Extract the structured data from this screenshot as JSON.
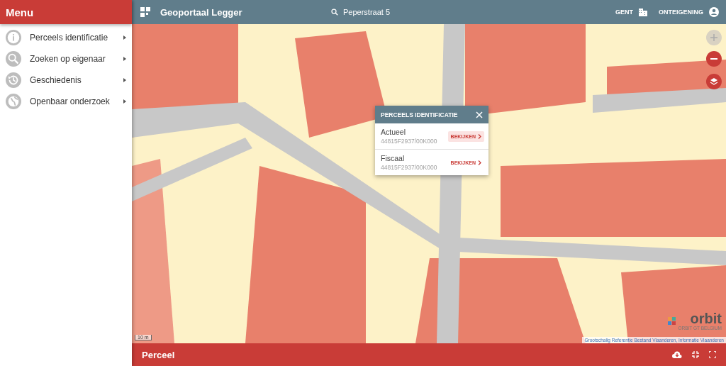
{
  "sidebar": {
    "title": "Menu",
    "items": [
      {
        "label": "Perceels identificatie"
      },
      {
        "label": "Zoeken op eigenaar"
      },
      {
        "label": "Geschiedenis"
      },
      {
        "label": "Openbaar onderzoek"
      }
    ]
  },
  "topbar": {
    "title": "Geoportaal Legger",
    "search": {
      "value": "Peperstraat 5"
    },
    "city": "GENT",
    "mode": "ONTEIGENING"
  },
  "map": {
    "zoom_in": {
      "disabled": true
    },
    "zoom_out": {
      "disabled": false
    },
    "scale": "10 m",
    "logo": {
      "name": "orbit",
      "subtitle": "ORBIT GT BELGIUM"
    },
    "attribution": "Grootschalig Referentie Bestand Vlaanderen, Informatie Vlaanderen"
  },
  "popup": {
    "title": "PERCEELS IDENTIFICATIE",
    "rows": [
      {
        "label": "Actueel",
        "code": "44815F2937/00K000",
        "action": "BEKIJKEN",
        "selected": true
      },
      {
        "label": "Fiscaal",
        "code": "44815F2937/00K000",
        "action": "BEKIJKEN",
        "selected": false
      }
    ]
  },
  "bottom_bar": {
    "title": "Perceel"
  }
}
